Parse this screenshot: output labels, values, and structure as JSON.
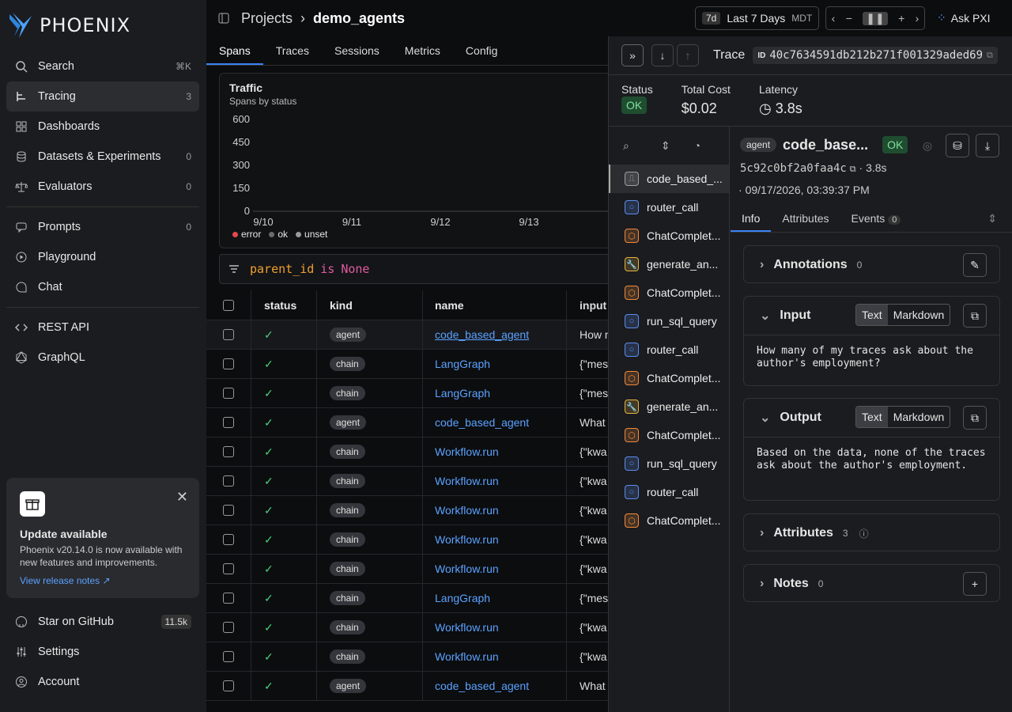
{
  "app": {
    "name": "PHOENIX"
  },
  "sidebar": {
    "items": [
      {
        "label": "Search",
        "shortcut": "⌘K"
      },
      {
        "label": "Tracing",
        "count": "3"
      },
      {
        "label": "Dashboards"
      },
      {
        "label": "Datasets & Experiments",
        "count": "0"
      },
      {
        "label": "Evaluators",
        "count": "0"
      },
      {
        "label": "Prompts",
        "count": "0"
      },
      {
        "label": "Playground"
      },
      {
        "label": "Chat"
      },
      {
        "label": "REST API"
      },
      {
        "label": "GraphQL"
      }
    ],
    "update": {
      "title": "Update available",
      "body": "Phoenix v20.14.0 is now available with new features and improvements.",
      "link": "View release notes"
    },
    "bottom": [
      {
        "label": "Star on GitHub",
        "badge": "11.5k"
      },
      {
        "label": "Settings"
      },
      {
        "label": "Account"
      }
    ]
  },
  "header": {
    "projects": "Projects",
    "project": "demo_agents",
    "range_short": "7d",
    "range": "Last 7 Days",
    "tz": "MDT",
    "ask": "Ask PXI"
  },
  "tabs": [
    "Spans",
    "Traces",
    "Sessions",
    "Metrics",
    "Config"
  ],
  "chart": {
    "title": "Traffic",
    "subtitle": "Spans by status",
    "legend": [
      "error",
      "ok",
      "unset"
    ]
  },
  "chart_data": {
    "type": "bar",
    "title": "Traffic",
    "subtitle": "Spans by status",
    "categories": [
      "9/10",
      "9/11",
      "9/12",
      "9/13"
    ],
    "yticks": [
      0,
      150,
      300,
      450,
      600
    ],
    "ylim": [
      0,
      600
    ],
    "series": [
      {
        "name": "error",
        "color": "#e5484d",
        "values": [
          0,
          0,
          0,
          0
        ]
      },
      {
        "name": "ok",
        "color": "#6b6b6b",
        "values": [
          0,
          0,
          0,
          0
        ]
      },
      {
        "name": "unset",
        "color": "#9a9a9a",
        "values": [
          0,
          0,
          0,
          0
        ]
      }
    ]
  },
  "filter": {
    "field": "parent_id",
    "op": "is",
    "value": "None"
  },
  "table": {
    "headers": [
      "status",
      "kind",
      "name",
      "input"
    ],
    "rows": [
      {
        "kind": "agent",
        "name": "code_based_agent",
        "input": "How m"
      },
      {
        "kind": "chain",
        "name": "LangGraph",
        "input": "{\"mes"
      },
      {
        "kind": "chain",
        "name": "LangGraph",
        "input": "{\"mes"
      },
      {
        "kind": "agent",
        "name": "code_based_agent",
        "input": "What"
      },
      {
        "kind": "chain",
        "name": "Workflow.run",
        "input": "{\"kwa"
      },
      {
        "kind": "chain",
        "name": "Workflow.run",
        "input": "{\"kwa"
      },
      {
        "kind": "chain",
        "name": "Workflow.run",
        "input": "{\"kwa"
      },
      {
        "kind": "chain",
        "name": "Workflow.run",
        "input": "{\"kwa"
      },
      {
        "kind": "chain",
        "name": "Workflow.run",
        "input": "{\"kwa"
      },
      {
        "kind": "chain",
        "name": "LangGraph",
        "input": "{\"mes"
      },
      {
        "kind": "chain",
        "name": "Workflow.run",
        "input": "{\"kwa"
      },
      {
        "kind": "chain",
        "name": "Workflow.run",
        "input": "{\"kwa"
      },
      {
        "kind": "agent",
        "name": "code_based_agent",
        "input": "What"
      }
    ]
  },
  "trace": {
    "label": "Trace",
    "id_prefix": "ID",
    "id": "40c7634591db212b271f001329aded69",
    "status_label": "Status",
    "status": "OK",
    "cost_label": "Total Cost",
    "cost": "$0.02",
    "latency_label": "Latency",
    "latency": "3.8s",
    "tree": [
      {
        "name": "code_based_...",
        "kind": "agent",
        "color": "#9aa0a6"
      },
      {
        "name": "router_call",
        "kind": "chain",
        "color": "#5b8def"
      },
      {
        "name": "ChatComplet...",
        "kind": "llm",
        "color": "#f08a3c"
      },
      {
        "name": "generate_an...",
        "kind": "tool",
        "color": "#e3b341"
      },
      {
        "name": "ChatComplet...",
        "kind": "llm",
        "color": "#f08a3c"
      },
      {
        "name": "run_sql_query",
        "kind": "chain",
        "color": "#5b8def"
      },
      {
        "name": "router_call",
        "kind": "chain",
        "color": "#5b8def"
      },
      {
        "name": "ChatComplet...",
        "kind": "llm",
        "color": "#f08a3c"
      },
      {
        "name": "generate_an...",
        "kind": "tool",
        "color": "#e3b341"
      },
      {
        "name": "ChatComplet...",
        "kind": "llm",
        "color": "#f08a3c"
      },
      {
        "name": "run_sql_query",
        "kind": "chain",
        "color": "#5b8def"
      },
      {
        "name": "router_call",
        "kind": "chain",
        "color": "#5b8def"
      },
      {
        "name": "ChatComplet...",
        "kind": "llm",
        "color": "#f08a3c"
      }
    ],
    "span": {
      "kind": "agent",
      "name": "code_base...",
      "status": "OK",
      "span_id": "5c92c0bf2a0faa4c",
      "latency": "3.8s",
      "time": "09/17/2026, 03:39:37 PM"
    },
    "detail_tabs": {
      "info": "Info",
      "attributes": "Attributes",
      "events": "Events",
      "events_count": "0"
    },
    "annotations": {
      "label": "Annotations",
      "count": "0"
    },
    "input": {
      "label": "Input",
      "text": "How many of my traces ask about the author's employment?"
    },
    "output": {
      "label": "Output",
      "text": "Based on the data, none of the traces ask about the author's employment."
    },
    "seg": {
      "text": "Text",
      "markdown": "Markdown"
    },
    "attributes": {
      "label": "Attributes",
      "count": "3"
    },
    "notes": {
      "label": "Notes",
      "count": "0"
    }
  }
}
